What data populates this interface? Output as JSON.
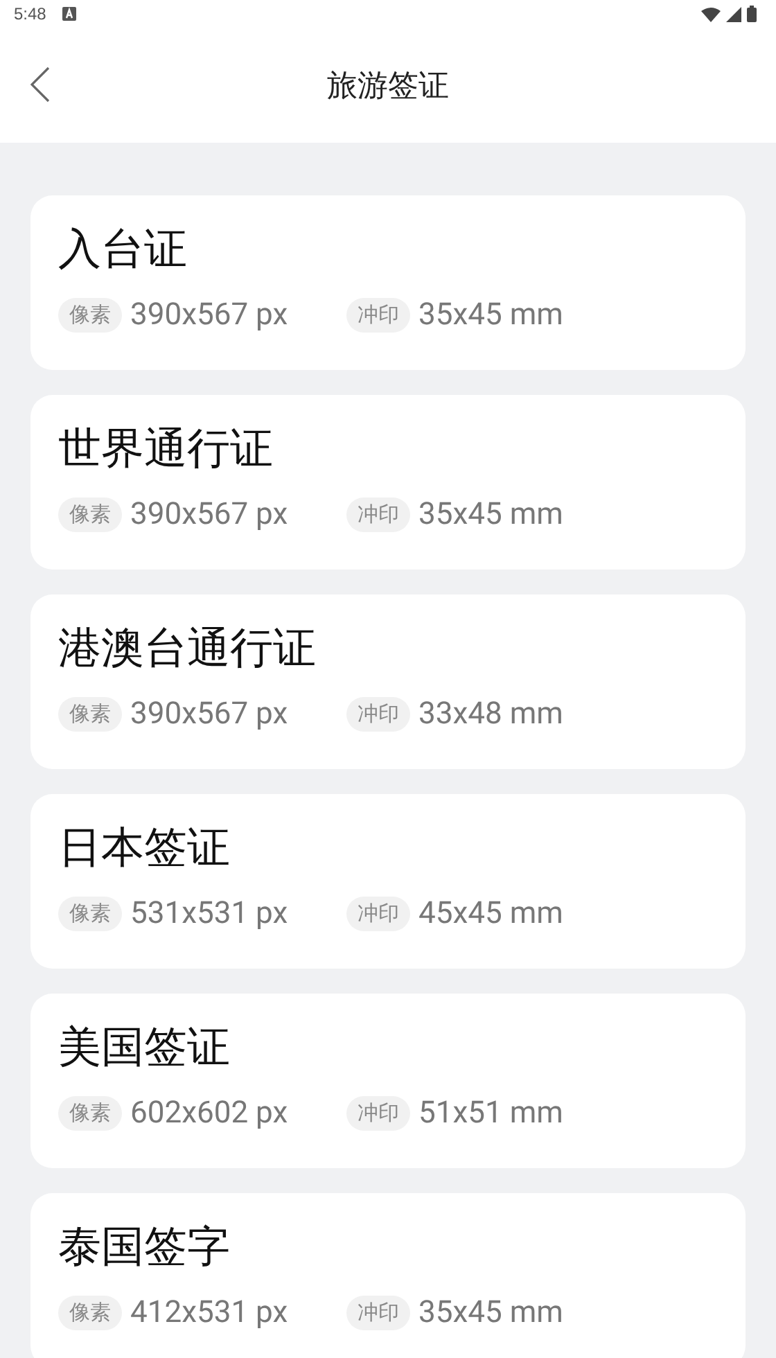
{
  "status_bar": {
    "time": "5:48"
  },
  "header": {
    "title": "旅游签证"
  },
  "cards": [
    {
      "title": "入台证",
      "pixel_label": "像素",
      "pixels": "390x567 px",
      "print_label": "冲印",
      "print": "35x45 mm"
    },
    {
      "title": "世界通行证",
      "pixel_label": "像素",
      "pixels": "390x567 px",
      "print_label": "冲印",
      "print": "35x45 mm"
    },
    {
      "title": "港澳台通行证",
      "pixel_label": "像素",
      "pixels": "390x567 px",
      "print_label": "冲印",
      "print": "33x48 mm"
    },
    {
      "title": "日本签证",
      "pixel_label": "像素",
      "pixels": "531x531 px",
      "print_label": "冲印",
      "print": "45x45 mm"
    },
    {
      "title": "美国签证",
      "pixel_label": "像素",
      "pixels": "602x602 px",
      "print_label": "冲印",
      "print": "51x51 mm"
    },
    {
      "title": "泰国签字",
      "pixel_label": "像素",
      "pixels": "412x531 px",
      "print_label": "冲印",
      "print": "35x45 mm"
    }
  ]
}
